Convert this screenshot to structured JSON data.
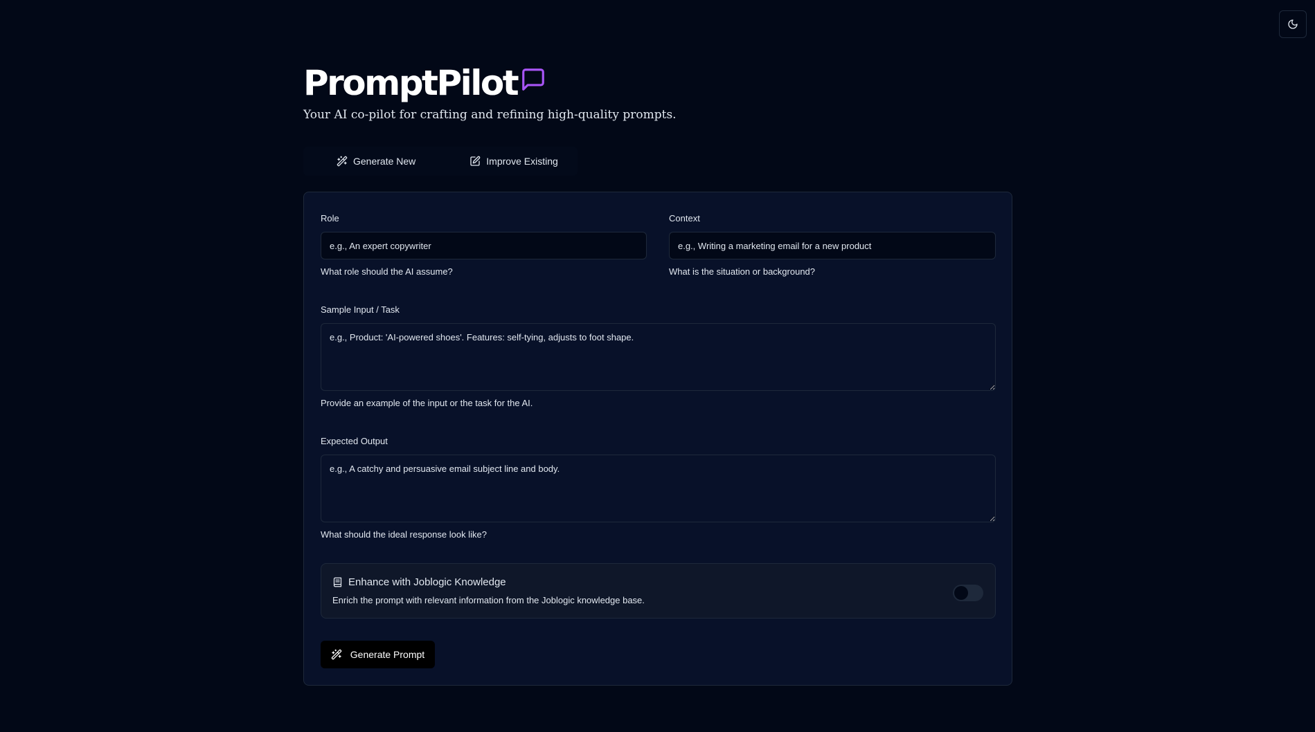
{
  "header": {
    "title": "PromptPilot",
    "title_icon": "message-square-icon",
    "subtitle": "Your AI co-pilot for crafting and refining high-quality prompts."
  },
  "theme_toggle": {
    "icon": "moon-icon"
  },
  "tabs": [
    {
      "label": "Generate New",
      "icon": "wand-icon"
    },
    {
      "label": "Improve Existing",
      "icon": "edit-icon"
    }
  ],
  "form": {
    "role": {
      "label": "Role",
      "placeholder": "e.g., An expert copywriter",
      "value": "",
      "hint": "What role should the AI assume?"
    },
    "context": {
      "label": "Context",
      "placeholder": "e.g., Writing a marketing email for a new product",
      "value": "",
      "hint": "What is the situation or background?"
    },
    "sample_input": {
      "label": "Sample Input / Task",
      "placeholder": "e.g., Product: 'AI-powered shoes'. Features: self-tying, adjusts to foot shape.",
      "value": "",
      "hint": "Provide an example of the input or the task for the AI."
    },
    "expected_output": {
      "label": "Expected Output",
      "placeholder": "e.g., A catchy and persuasive email subject line and body.",
      "value": "",
      "hint": "What should the ideal response look like?"
    },
    "enhance": {
      "title": "Enhance with Joblogic Knowledge",
      "description": "Enrich the prompt with relevant information from the Joblogic knowledge base.",
      "icon": "book-icon",
      "enabled": false
    },
    "submit": {
      "label": "Generate Prompt",
      "icon": "wand-icon"
    }
  },
  "colors": {
    "background": "#020817",
    "card": "#081129",
    "accent": "#a855f7",
    "border": "#1e293b"
  }
}
